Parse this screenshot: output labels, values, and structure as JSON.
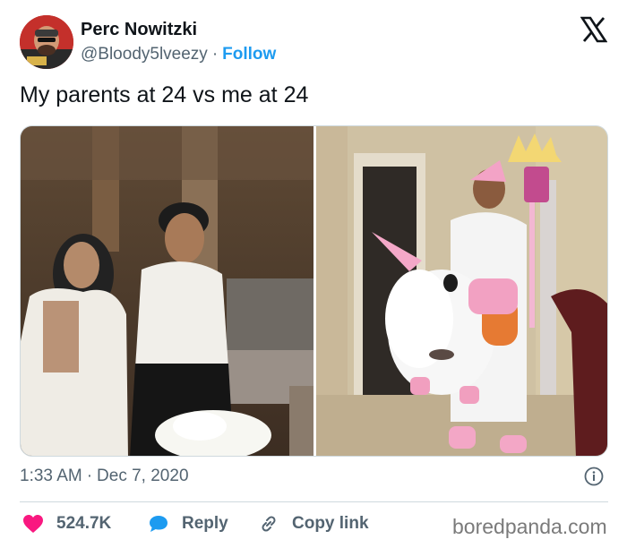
{
  "author": {
    "name": "Perc Nowitzki",
    "handle": "@Bloody5lveezy",
    "separator": "·",
    "follow_label": "Follow"
  },
  "icons": {
    "logo": "x-logo-icon",
    "info": "info-icon",
    "like": "heart-icon",
    "reply": "speech-bubble-icon",
    "copy": "link-icon"
  },
  "tweet": {
    "text": "My parents at 24 vs me at 24"
  },
  "meta": {
    "time": "1:33 AM",
    "separator": "·",
    "date": "Dec 7, 2020"
  },
  "actions": {
    "likes": "524.7K",
    "reply_label": "Reply",
    "copy_label": "Copy link"
  },
  "watermark": "boredpanda.com",
  "colors": {
    "accent": "#1d9bf0",
    "like": "#f91880",
    "text": "#0f1419",
    "secondary": "#536471",
    "border": "#cfd9de"
  }
}
